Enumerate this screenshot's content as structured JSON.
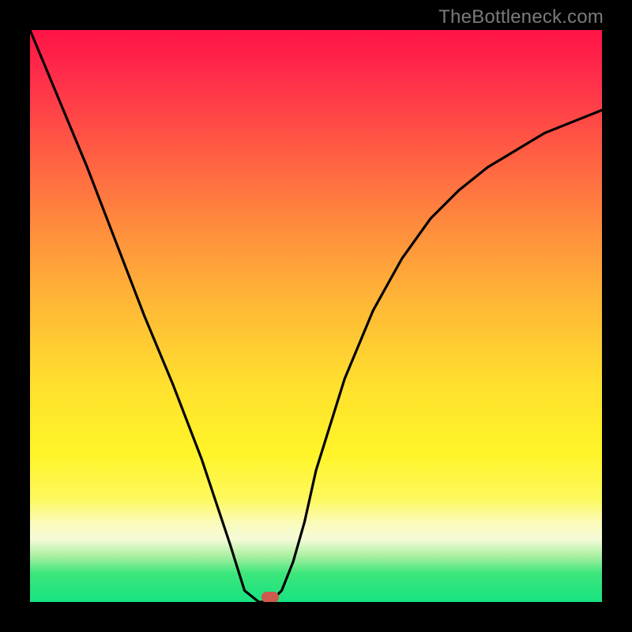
{
  "attribution": "TheBottleneck.com",
  "chart_data": {
    "type": "line",
    "title": "",
    "xlabel": "",
    "ylabel": "",
    "xlim": [
      0,
      1
    ],
    "ylim": [
      0,
      1
    ],
    "x": [
      0.0,
      0.05,
      0.1,
      0.15,
      0.2,
      0.25,
      0.3,
      0.35,
      0.375,
      0.4,
      0.42,
      0.44,
      0.46,
      0.48,
      0.5,
      0.55,
      0.6,
      0.65,
      0.7,
      0.75,
      0.8,
      0.85,
      0.9,
      0.95,
      1.0
    ],
    "values": [
      1.0,
      0.88,
      0.76,
      0.63,
      0.5,
      0.38,
      0.25,
      0.1,
      0.02,
      0.0,
      0.0,
      0.02,
      0.07,
      0.14,
      0.23,
      0.39,
      0.51,
      0.6,
      0.67,
      0.72,
      0.76,
      0.79,
      0.82,
      0.84,
      0.86
    ],
    "marker": {
      "x": 0.42,
      "y": 0.005
    },
    "gradient_stops": [
      {
        "pos": 0.0,
        "color": "#ff1447"
      },
      {
        "pos": 0.62,
        "color": "#ffe02e"
      },
      {
        "pos": 0.89,
        "color": "#f6fbd8"
      },
      {
        "pos": 1.0,
        "color": "#17e380"
      }
    ]
  }
}
